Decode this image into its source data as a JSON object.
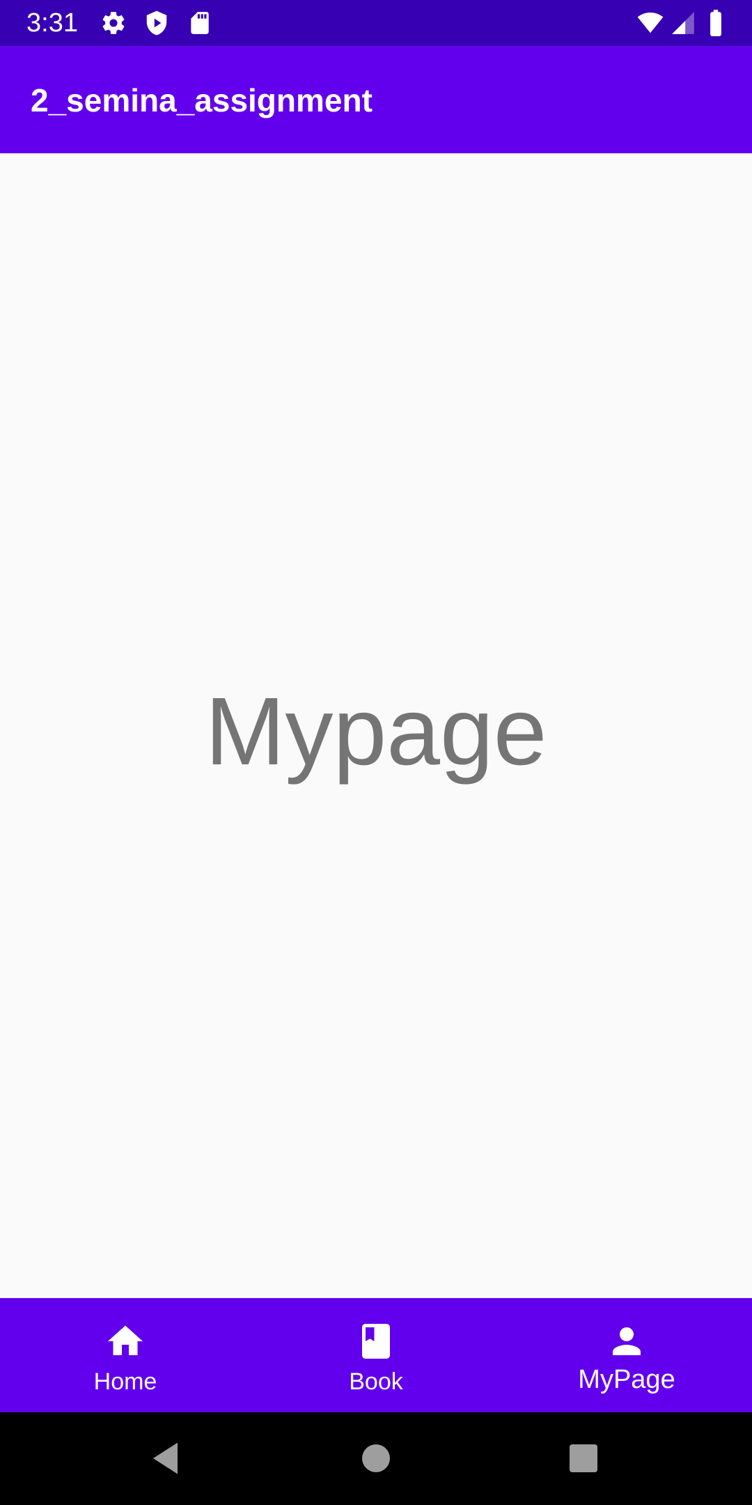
{
  "status_bar": {
    "time": "3:31",
    "background_color": "#3700b3",
    "left_icons": [
      "settings-icon",
      "shield-icon",
      "sd-card-icon"
    ],
    "right_icons": [
      "wifi-icon",
      "cell-signal-icon",
      "battery-icon"
    ]
  },
  "app_bar": {
    "title": "2_semina_assignment",
    "background_color": "#6200ee"
  },
  "content": {
    "label": "Mypage"
  },
  "bottom_nav": {
    "background_color": "#6200ee",
    "selected": "MyPage",
    "items": [
      {
        "label": "Home",
        "icon": "home-icon"
      },
      {
        "label": "Book",
        "icon": "book-icon"
      },
      {
        "label": "MyPage",
        "icon": "person-icon"
      }
    ]
  },
  "system_nav": {
    "buttons": [
      "back-icon",
      "home-circle-icon",
      "recents-icon"
    ]
  }
}
